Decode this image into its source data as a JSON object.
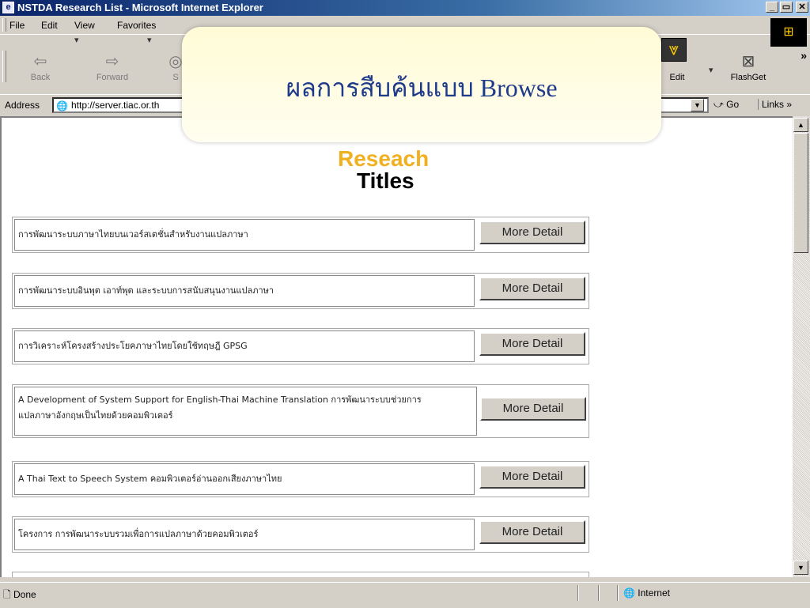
{
  "window": {
    "title": "NSTDA Research List - Microsoft Internet Explorer",
    "controls": [
      "_",
      "▭",
      "✕"
    ]
  },
  "menu": {
    "file": "File",
    "edit": "Edit",
    "view": "View",
    "favorites": "Favorites"
  },
  "toolbar": {
    "back": "Back",
    "forward": "Forward",
    "stop_partial": "S",
    "edit": "Edit",
    "flashget": "FlashGet",
    "more": "»"
  },
  "address": {
    "label": "Address",
    "url": "http://server.tiac.or.th",
    "go": "Go",
    "links": "Links »"
  },
  "overlay": {
    "text": "ผลการสืบค้นแบบ Browse"
  },
  "page": {
    "heading_line1": "Reseach",
    "heading_line2": "Titles",
    "button_label": "More Detail",
    "rows": [
      {
        "title": "การพัฒนาระบบภาษาไทยบนเวอร์สเตชั่นสำหรับงานแปลภาษา"
      },
      {
        "title": "การพัฒนาระบบอินพุต เอาท์พุต และระบบการสนับสนุนงานแปลภาษา"
      },
      {
        "title": "การวิเคราะห์โครงสร้างประโยคภาษาไทยโดยใช้ทฤษฎี GPSG"
      },
      {
        "title": "A Development of System Support for English-Thai Machine Translation การพัฒนาระบบช่วยการ",
        "title2": "แปลภาษาอังกฤษเป็นไทยด้วยคอมพิวเตอร์"
      },
      {
        "title": "A Thai Text to Speech System คอมพิวเตอร์อ่านออกเสียงภาษาไทย"
      },
      {
        "title": "โครงการ การพัฒนาระบบรวมเพื่อการแปลภาษาด้วยคอมพิวเตอร์"
      }
    ]
  },
  "status": {
    "text": "Done",
    "zone": "Internet"
  },
  "colors": {
    "titlebar": "#0a246a",
    "heading_accent": "#f0b020",
    "overlay_text": "#1e3a8a"
  }
}
